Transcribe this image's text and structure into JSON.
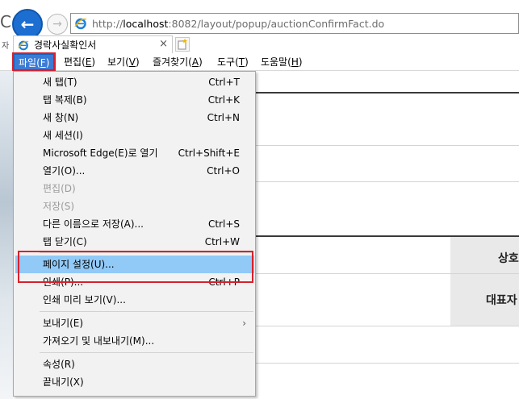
{
  "browser": {
    "url_prefix": "http://",
    "url_host": "localhost",
    "url_path": ":8082/layout/popup/auctionConfirmFact.do",
    "left_fragment": "C",
    "side_char": "자"
  },
  "tab": {
    "title": "경락사실확인서",
    "close": "×"
  },
  "menu": [
    {
      "label": "파일",
      "key": "F"
    },
    {
      "label": "편집",
      "key": "E"
    },
    {
      "label": "보기",
      "key": "V"
    },
    {
      "label": "즐겨찾기",
      "key": "A"
    },
    {
      "label": "도구",
      "key": "T"
    },
    {
      "label": "도움말",
      "key": "H"
    }
  ],
  "file_menu": {
    "items": [
      {
        "label": "새 탭(T)",
        "shortcut": "Ctrl+T"
      },
      {
        "label": "탭 복제(B)",
        "shortcut": "Ctrl+K"
      },
      {
        "label": "새 창(N)",
        "shortcut": "Ctrl+N"
      },
      {
        "label": "새 세션(I)",
        "shortcut": ""
      },
      {
        "label": "Microsoft Edge(E)로 열기",
        "shortcut": "Ctrl+Shift+E"
      },
      {
        "label": "열기(O)...",
        "shortcut": "Ctrl+O"
      },
      {
        "label": "편집(D)",
        "shortcut": ""
      },
      {
        "label": "저장(S)",
        "shortcut": ""
      },
      {
        "label": "다른 이름으로 저장(A)...",
        "shortcut": "Ctrl+S"
      },
      {
        "label": "탭 닫기(C)",
        "shortcut": "Ctrl+W"
      },
      {
        "label": "페이지 설정(U)...",
        "shortcut": ""
      },
      {
        "label": "인쇄(P)...",
        "shortcut": "Ctrl+P"
      },
      {
        "label": "인쇄 미리 보기(V)...",
        "shortcut": ""
      },
      {
        "label": "보내기(E)",
        "shortcut": ""
      },
      {
        "label": "가져오기 및 내보내기(M)...",
        "shortcut": ""
      },
      {
        "label": "속성(R)",
        "shortcut": ""
      },
      {
        "label": "끝내기(X)",
        "shortcut": ""
      }
    ],
    "arrow": "›"
  },
  "page": {
    "cell1": "상호",
    "cell2": "대표자"
  },
  "colors": {
    "highlight": "#91c9f7",
    "annotation_red": "#d8202d",
    "menu_active": "#3a7bd5"
  }
}
